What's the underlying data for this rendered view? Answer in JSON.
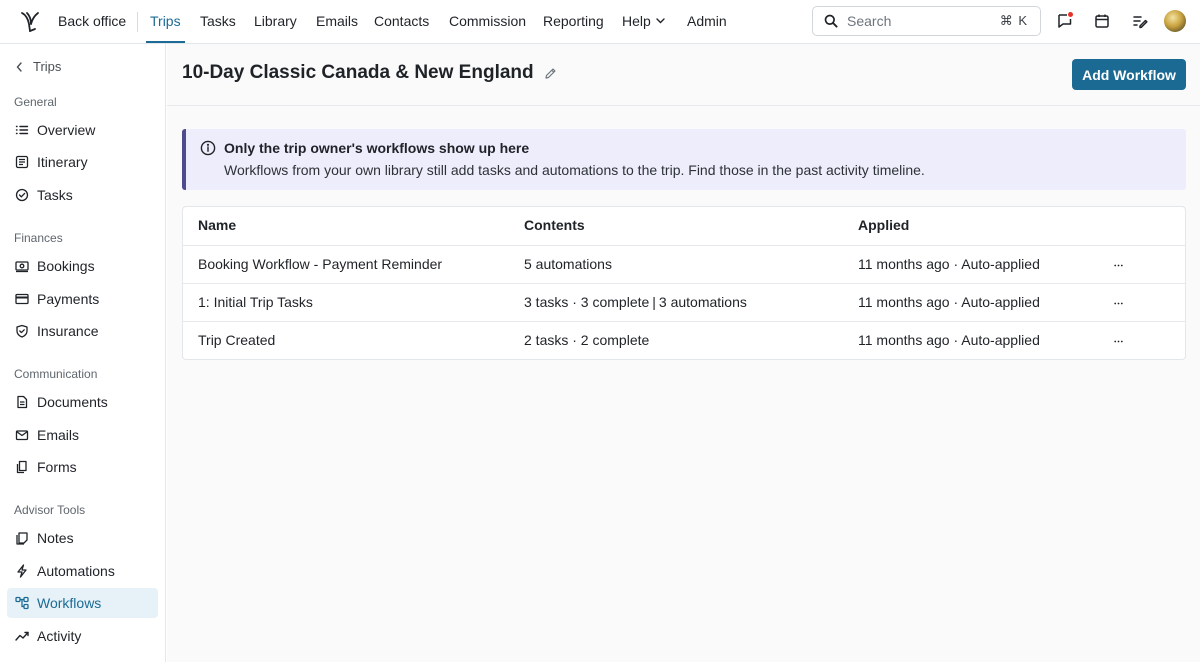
{
  "nav": {
    "brand_icon": "logo-icon",
    "back_office": "Back office",
    "links": [
      "Trips",
      "Tasks",
      "Library",
      "Emails",
      "Contacts",
      "Commission",
      "Reporting",
      "Help",
      "Admin"
    ],
    "active": "Trips",
    "search_placeholder": "Search",
    "search_shortcut": "⌘ K",
    "accent_color": "#1c6b94"
  },
  "sidebar": {
    "back_label": "Trips",
    "sections": [
      {
        "label": "General",
        "items": [
          {
            "label": "Overview",
            "icon": "list-icon"
          },
          {
            "label": "Itinerary",
            "icon": "itinerary-icon"
          },
          {
            "label": "Tasks",
            "icon": "check-circle-icon"
          }
        ]
      },
      {
        "label": "Finances",
        "items": [
          {
            "label": "Bookings",
            "icon": "bookings-icon"
          },
          {
            "label": "Payments",
            "icon": "card-icon"
          },
          {
            "label": "Insurance",
            "icon": "shield-icon"
          }
        ]
      },
      {
        "label": "Communication",
        "items": [
          {
            "label": "Documents",
            "icon": "document-icon"
          },
          {
            "label": "Emails",
            "icon": "mail-icon"
          },
          {
            "label": "Forms",
            "icon": "forms-icon"
          }
        ]
      },
      {
        "label": "Advisor Tools",
        "items": [
          {
            "label": "Notes",
            "icon": "notes-icon"
          },
          {
            "label": "Automations",
            "icon": "bolt-icon"
          },
          {
            "label": "Workflows",
            "icon": "workflow-icon"
          },
          {
            "label": "Activity",
            "icon": "activity-icon"
          }
        ]
      }
    ],
    "active": "Workflows"
  },
  "page": {
    "title": "10-Day Classic Canada & New England",
    "add_button": "Add Workflow"
  },
  "alert": {
    "title": "Only the trip owner's workflows show up here",
    "body": "Workflows from your own library still add tasks and automations to the trip. Find those in the past activity timeline."
  },
  "table": {
    "headers": [
      "Name",
      "Contents",
      "Applied"
    ],
    "rows": [
      {
        "name": "Booking Workflow - Payment Reminder",
        "contents": "5 automations",
        "contents_extra": "",
        "applied": "11 months ago · Auto-applied"
      },
      {
        "name": "1: Initial Trip Tasks",
        "contents": "3 tasks · 3 complete",
        "contents_extra": "3 automations",
        "applied": "11 months ago · Auto-applied"
      },
      {
        "name": "Trip Created",
        "contents": "2 tasks · 2 complete",
        "contents_extra": "",
        "applied": "11 months ago · Auto-applied"
      }
    ]
  }
}
